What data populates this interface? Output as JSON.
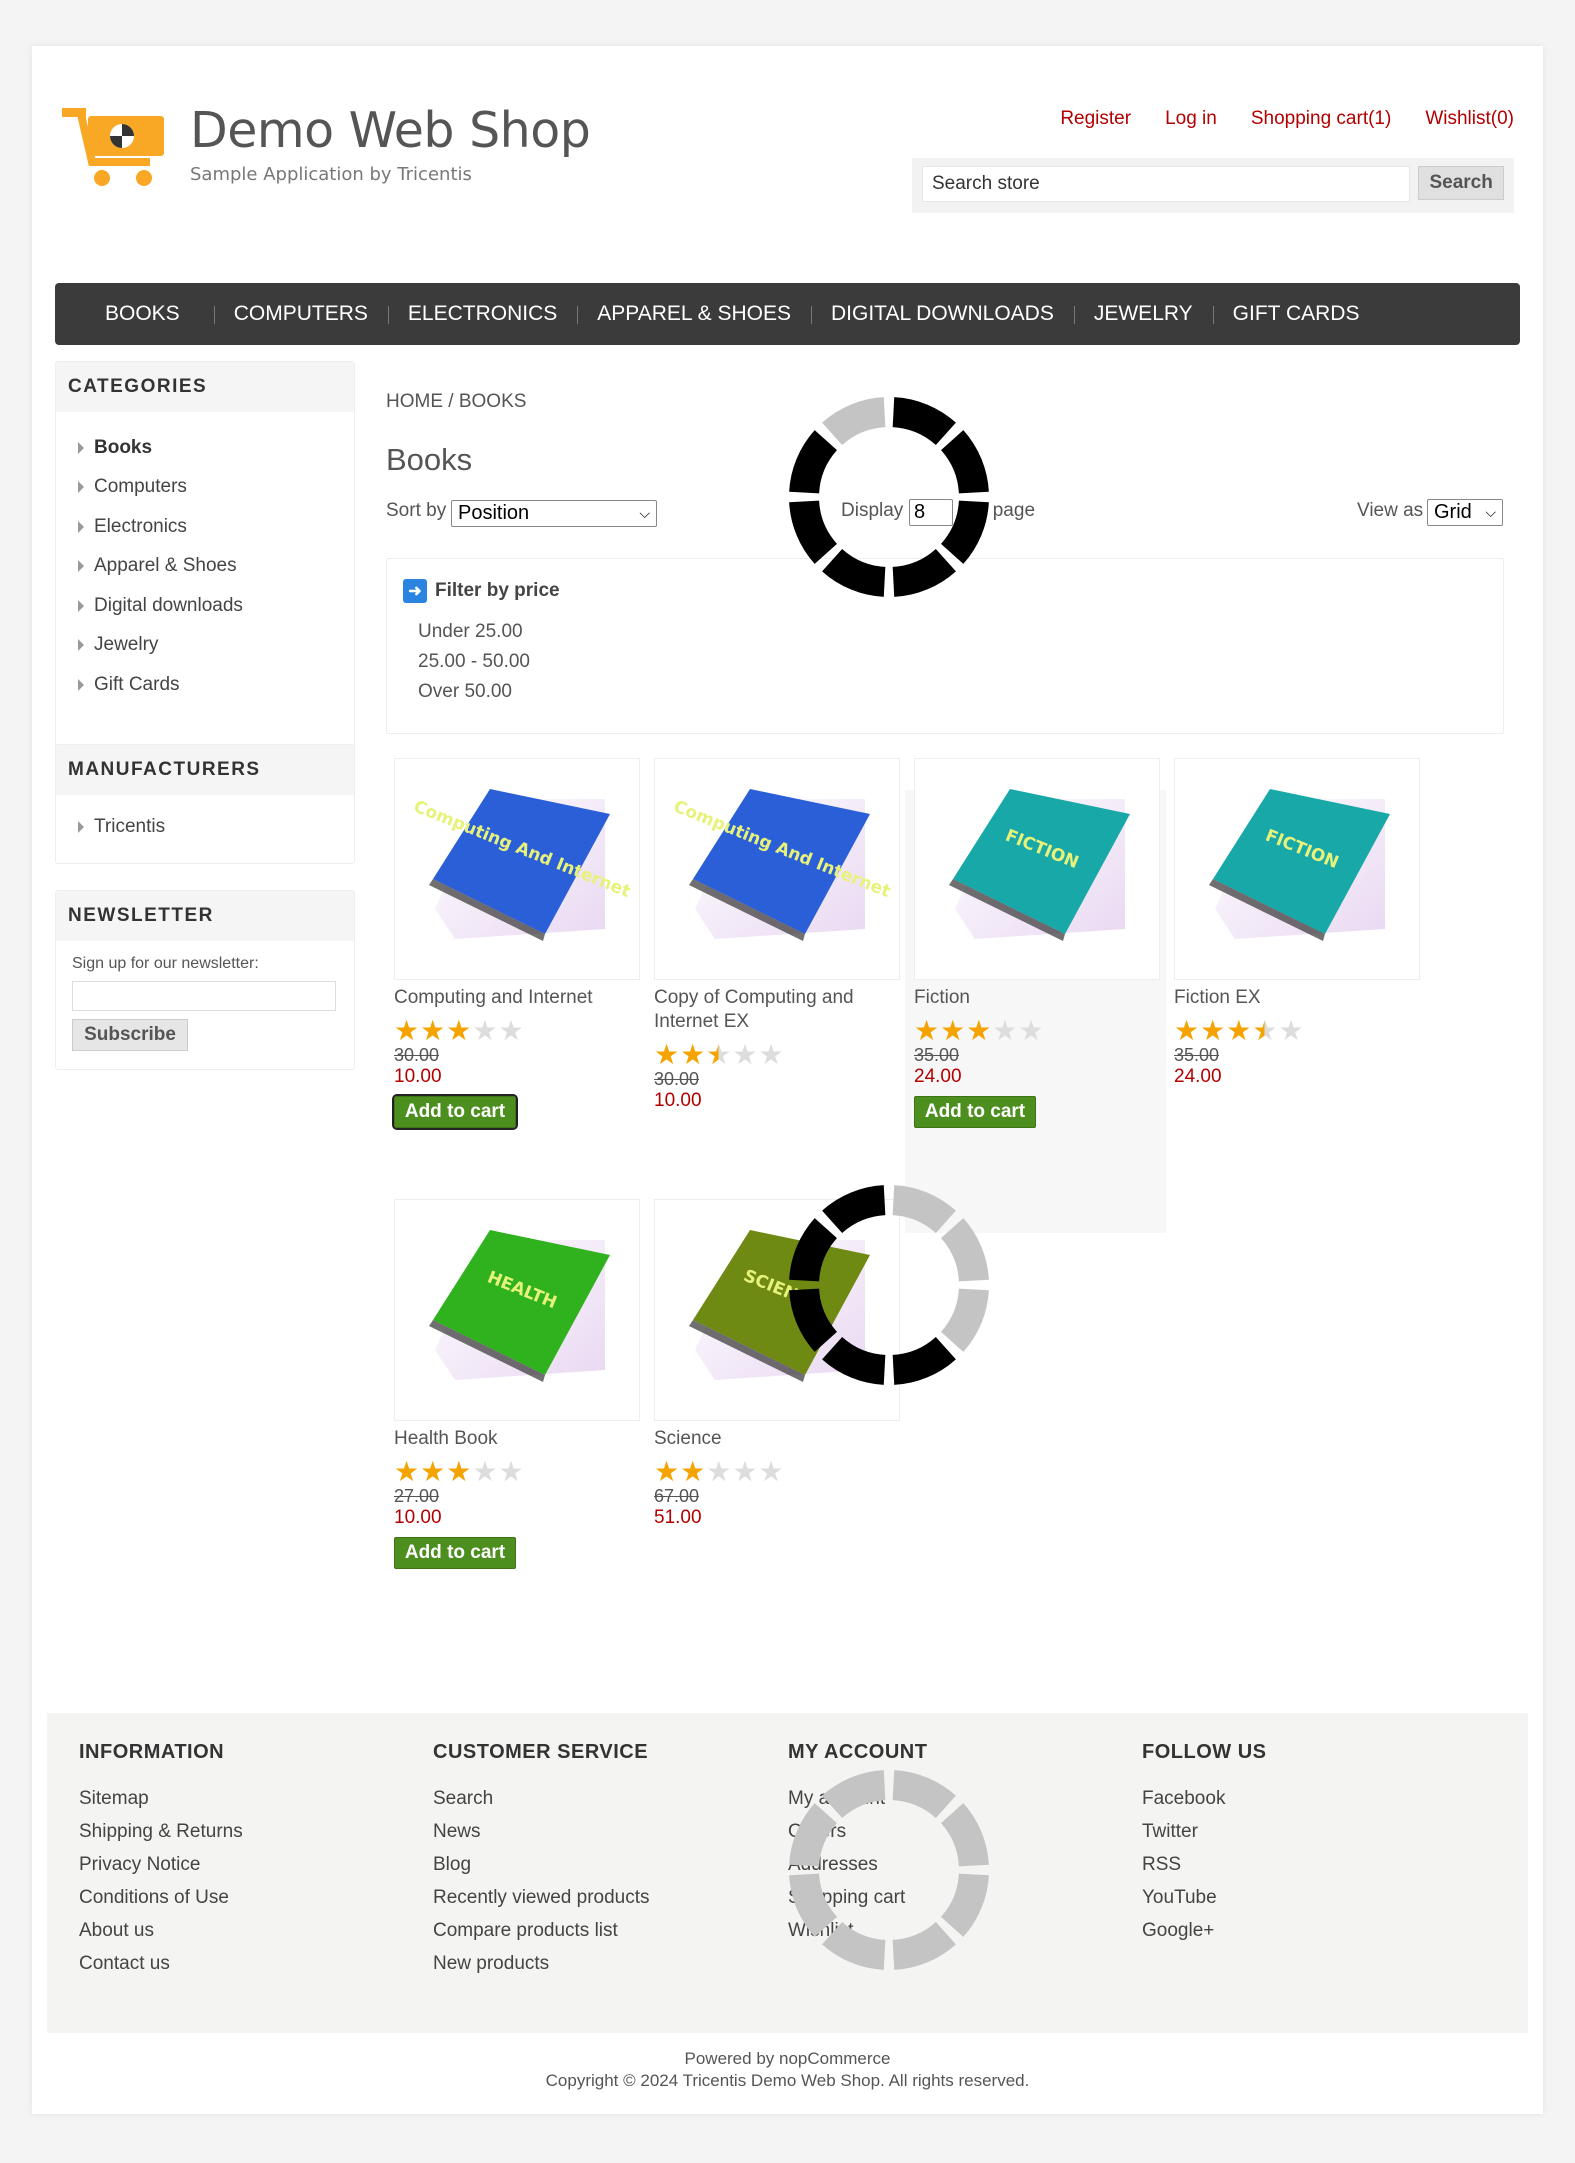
{
  "header": {
    "logo_title": "Demo Web Shop",
    "logo_subtitle": "Sample Application by Tricentis",
    "links": [
      "Register",
      "Log in",
      "Shopping cart(1)",
      "Wishlist(0)"
    ],
    "search_placeholder": "Search store",
    "search_button": "Search"
  },
  "topmenu": [
    "BOOKS",
    "COMPUTERS",
    "ELECTRONICS",
    "APPAREL & SHOES",
    "DIGITAL DOWNLOADS",
    "JEWELRY",
    "GIFT CARDS"
  ],
  "sidebar": {
    "categories_title": "CATEGORIES",
    "categories": [
      "Books",
      "Computers",
      "Electronics",
      "Apparel & Shoes",
      "Digital downloads",
      "Jewelry",
      "Gift Cards"
    ],
    "manufacturers_title": "MANUFACTURERS",
    "manufacturers": [
      "Tricentis"
    ],
    "newsletter_title": "NEWSLETTER",
    "newsletter_label": "Sign up for our newsletter:",
    "subscribe_button": "Subscribe"
  },
  "main": {
    "breadcrumb_home": "HOME",
    "breadcrumb_sep": "/",
    "breadcrumb_current": "BOOKS",
    "page_title": "Books",
    "sort_label": "Sort by",
    "sort_value": "Position",
    "display_label": "Display",
    "display_value": "8",
    "display_suffix": "per page",
    "view_label": "View as",
    "view_value": "Grid",
    "filter_title": "Filter by price",
    "filter_options": [
      "Under 25.00",
      "25.00 - 50.00",
      "Over 50.00"
    ]
  },
  "products": [
    {
      "name": "Computing and Internet",
      "rating": 3,
      "old_price": "30.00",
      "price": "10.00",
      "add_to_cart": "Add to cart",
      "book_color": "#2a5fd8",
      "book_title": "Computing And Internet"
    },
    {
      "name": "Copy of Computing and Internet EX",
      "rating": 2.5,
      "old_price": "30.00",
      "price": "10.00",
      "add_to_cart": "",
      "book_color": "#2a5fd8",
      "book_title": "Computing And Internet"
    },
    {
      "name": "Fiction",
      "rating": 3,
      "old_price": "35.00",
      "price": "24.00",
      "add_to_cart": "Add to cart",
      "book_color": "#18a8a8",
      "book_title": "FICTION"
    },
    {
      "name": "Fiction EX",
      "rating": 3.5,
      "old_price": "35.00",
      "price": "24.00",
      "add_to_cart": "",
      "book_color": "#18a8a8",
      "book_title": "FICTION"
    },
    {
      "name": "Health Book",
      "rating": 3,
      "old_price": "27.00",
      "price": "10.00",
      "add_to_cart": "Add to cart",
      "book_color": "#2fb21e",
      "book_title": "HEALTH"
    },
    {
      "name": "Science",
      "rating": 2,
      "old_price": "67.00",
      "price": "51.00",
      "add_to_cart": "",
      "book_color": "#6f8a12",
      "book_title": "SCIENCE"
    }
  ],
  "footer": {
    "columns": [
      {
        "title": "INFORMATION",
        "links": [
          "Sitemap",
          "Shipping & Returns",
          "Privacy Notice",
          "Conditions of Use",
          "About us",
          "Contact us"
        ]
      },
      {
        "title": "CUSTOMER SERVICE",
        "links": [
          "Search",
          "News",
          "Blog",
          "Recently viewed products",
          "Compare products list",
          "New products"
        ]
      },
      {
        "title": "MY ACCOUNT",
        "links": [
          "My account",
          "Orders",
          "Addresses",
          "Shopping cart",
          "Wishlist"
        ]
      },
      {
        "title": "FOLLOW US",
        "links": [
          "Facebook",
          "Twitter",
          "RSS",
          "YouTube",
          "Google+"
        ]
      }
    ],
    "powered_by": "Powered by nopCommerce",
    "copyright": "Copyright © 2024 Tricentis Demo Web Shop. All rights reserved."
  },
  "colors": {
    "link_red": "#b30000",
    "menu_bg": "#3b3b3b",
    "add_to_cart_green": "#4d8f1f",
    "star_gold": "#f4a300",
    "logo_orange": "#f9a826"
  }
}
